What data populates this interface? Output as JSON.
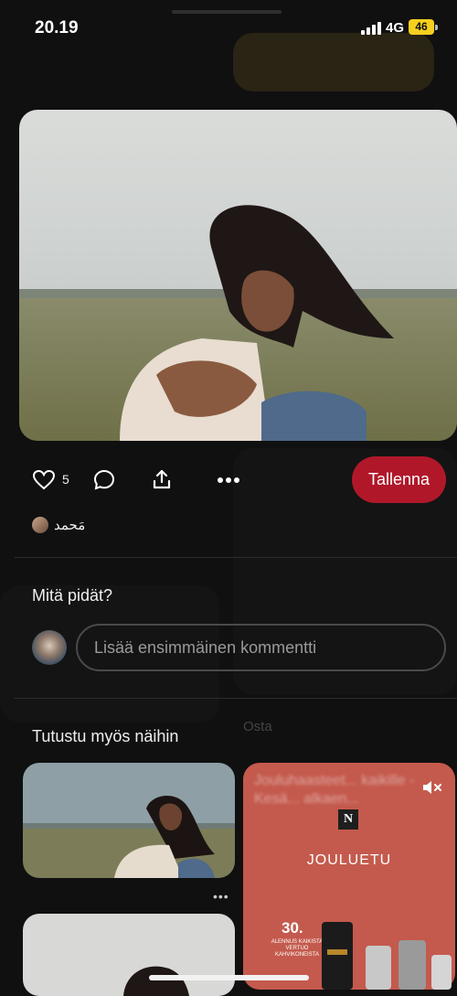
{
  "status_bar": {
    "time": "20.19",
    "network": "4G",
    "battery": "46"
  },
  "pin": {
    "likes": "5",
    "save_label": "Tallenna",
    "author": "مَحمد"
  },
  "comments": {
    "title": "Mitä pidät?",
    "placeholder": "Lisää ensimmäinen kommentti"
  },
  "related": {
    "title": "Tutustu myös näihin",
    "more_label": "•••"
  },
  "background": {
    "buy_label": "Osta"
  },
  "ad": {
    "blurred_text": "Jouluhaasteet... kaikille - Kesä... alkaen...",
    "brand_letter": "N",
    "title": "JOULUETU",
    "discount": "30.",
    "fine_print": "ALENNUS KAIKISTA VERTUO KAHVIKONEISTA"
  },
  "colors": {
    "save_button": "#b0182a",
    "background": "#101010",
    "ad_background": "#c45a4d"
  }
}
